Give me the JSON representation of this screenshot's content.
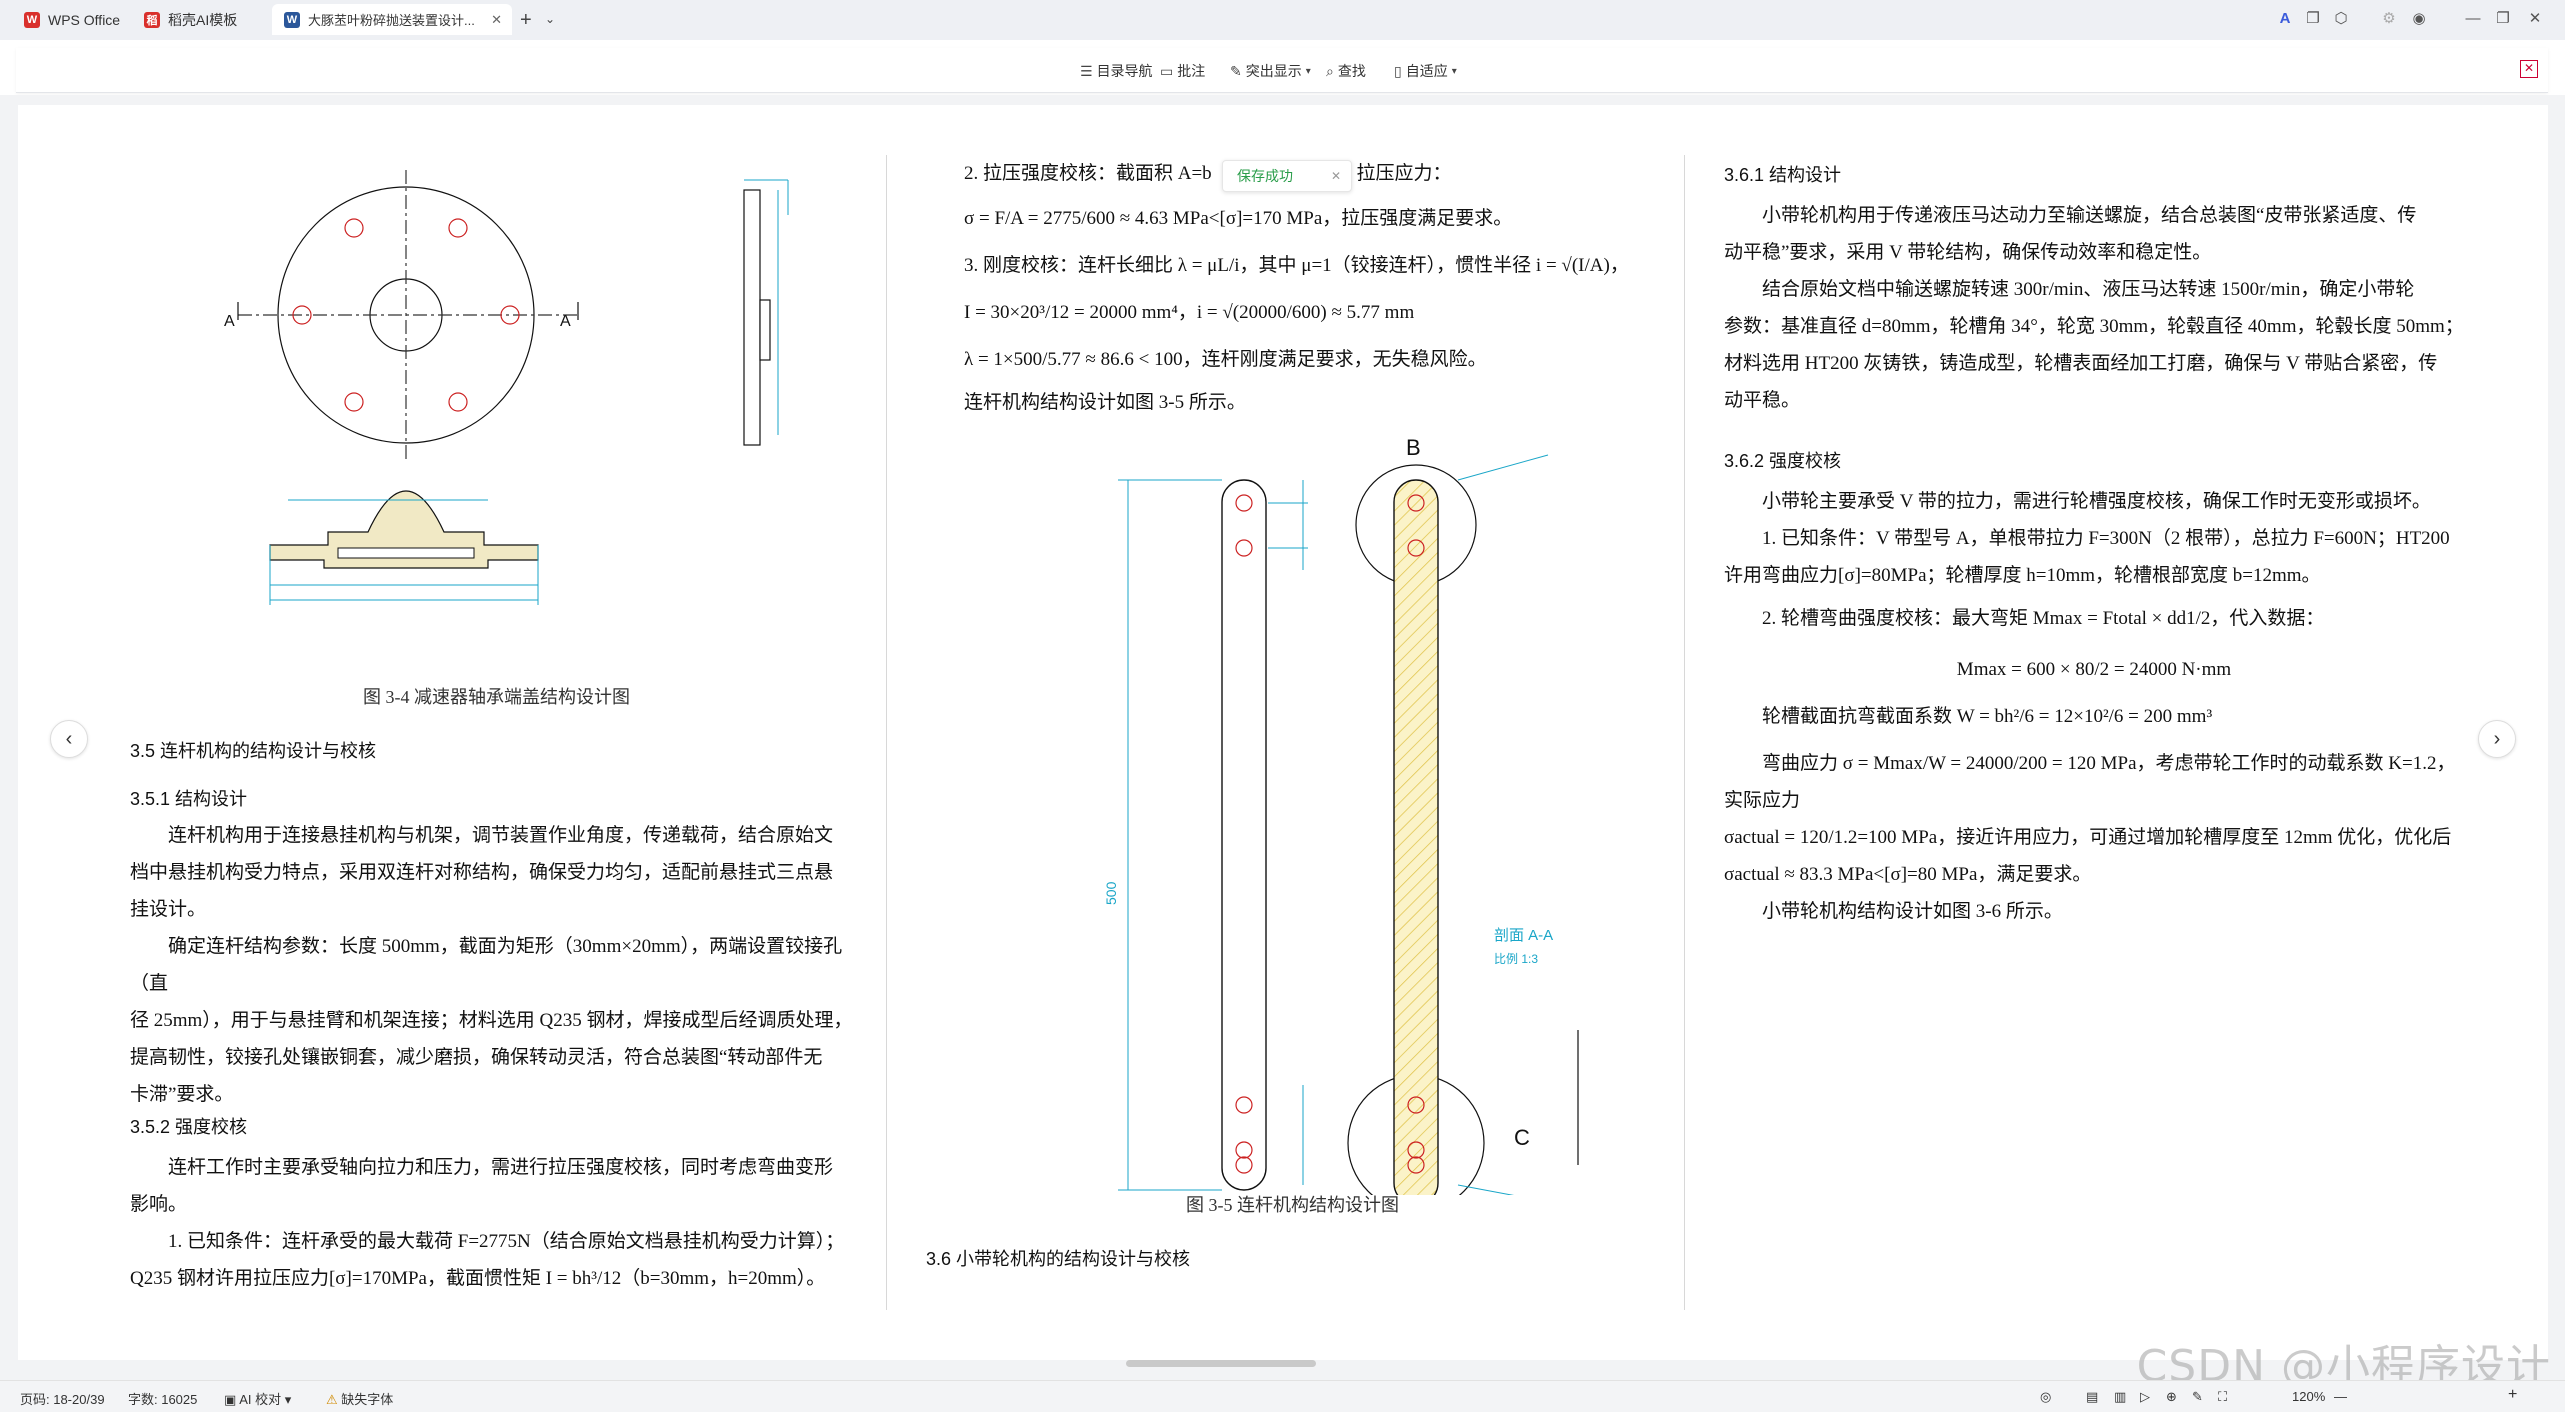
{
  "tabs": [
    {
      "label": "WPS Office",
      "color": "#d9302c"
    },
    {
      "label": "稻壳AI模板",
      "color": "#d9302c"
    },
    {
      "label": "大豚苤叶粉碎抛送装置设计...",
      "color": "#2b579a"
    }
  ],
  "toolbar": {
    "nav": "目录导航",
    "comment": "批注",
    "highlight": "突出显示",
    "find": "查找",
    "fit": "自适应"
  },
  "toast": "保存成功",
  "col1": {
    "fig34_caption": "图 3-4  减速器轴承端盖结构设计图",
    "h35": "3.5 连杆机构的结构设计与校核",
    "h351": "3.5.1  结构设计",
    "p1": [
      "连杆机构用于连接悬挂机构与机架，调节装置作业角度，传递载荷，结合原始文",
      "档中悬挂机构受力特点，采用双连杆对称结构，确保受力均匀，适配前悬挂式三点悬",
      "挂设计。"
    ],
    "p2": [
      "确定连杆结构参数：长度 500mm，截面为矩形（30mm×20mm），两端设置铰接孔（直",
      "径 25mm），用于与悬挂臂和机架连接；材料选用 Q235 钢材，焊接成型后经调质处理，",
      "提高韧性，铰接孔处镶嵌铜套，减少磨损，确保转动灵活，符合总装图“转动部件无",
      "卡滞”要求。"
    ],
    "h352": "3.5.2  强度校核",
    "p3": [
      "连杆工作时主要承受轴向拉力和压力，需进行拉压强度校核，同时考虑弯曲变形",
      "影响。"
    ],
    "p4": [
      "1. 已知条件：连杆承受的最大载荷 F=2775N（结合原始文档悬挂机构受力计算）；",
      "Q235 钢材许用拉压应力[σ]=170MPa，截面惯性矩 I = bh³/12（b=30mm，h=20mm）。"
    ]
  },
  "col2": {
    "l1": "2. 拉压强度校核：截面积 A=b",
    "l1b": "mm², 拉压应力：",
    "l2": "σ = F/A = 2775/600 ≈ 4.63 MPa<[σ]=170 MPa，拉压强度满足要求。",
    "l3": "3. 刚度校核：连杆长细比 λ = μL/i，其中 μ=1（铰接连杆），惯性半径 i = √(I/A)，",
    "l4": "I = 30×20³/12 = 20000 mm⁴，i = √(20000/600) ≈ 5.77 mm",
    "l5": "λ = 1×500/5.77 ≈ 86.6 < 100，连杆刚度满足要求，无失稳风险。",
    "l6": "连杆机构结构设计如图 3-5 所示。",
    "fig35_caption": "图 3-5  连杆机构结构设计图",
    "h36": "3.6 小带轮机构的结构设计与校核",
    "label_b": "B",
    "label_c": "C",
    "section": "剖面  A-A",
    "scale": "比例  1:3",
    "dim_len": "500"
  },
  "col3": {
    "h361": "3.6.1  结构设计",
    "p1": [
      "小带轮机构用于传递液压马达动力至输送螺旋，结合总装图“皮带张紧适度、传",
      "动平稳”要求，采用 V 带轮结构，确保传动效率和稳定性。"
    ],
    "p2": [
      "结合原始文档中输送螺旋转速 300r/min、液压马达转速 1500r/min，确定小带轮",
      "参数：基准直径 d=80mm，轮槽角 34°，轮宽 30mm，轮毂直径 40mm，轮毂长度 50mm；",
      "材料选用 HT200 灰铸铁，铸造成型，轮槽表面经加工打磨，确保与 V 带贴合紧密，传",
      "动平稳。"
    ],
    "h362": "3.6.2  强度校核",
    "p3": "小带轮主要承受 V 带的拉力，需进行轮槽强度校核，确保工作时无变形或损坏。",
    "p4": [
      "1. 已知条件：V 带型号 A，单根带拉力 F=300N（2 根带），总拉力 F=600N；HT200",
      "许用弯曲应力[σ]=80MPa；轮槽厚度 h=10mm，轮槽根部宽度 b=12mm。"
    ],
    "p5": "2. 轮槽弯曲强度校核：最大弯矩 Mmax = Ftotal × dd1/2，代入数据：",
    "f1": "Mmax = 600 × 80/2 = 24000 N·mm",
    "p6": "轮槽截面抗弯截面系数 W = bh²/6 = 12×10²/6 = 200 mm³",
    "p7": [
      "弯曲应力 σ = Mmax/W = 24000/200 = 120 MPa，考虑带轮工作时的动载系数 K=1.2，实际应力",
      "σactual = 120/1.2=100 MPa，接近许用应力，可通过增加轮槽厚度至 12mm 优化，优化后",
      "σactual ≈ 83.3 MPa<[σ]=80 MPa，满足要求。"
    ],
    "p8": "小带轮机构结构设计如图 3-6 所示。"
  },
  "status": {
    "page": "页码: 18-20/39",
    "words": "字数: 16025",
    "ai": "AI 校对",
    "font": "缺失字体",
    "zoom": "120%"
  },
  "watermark": "CSDN @小程序设计"
}
